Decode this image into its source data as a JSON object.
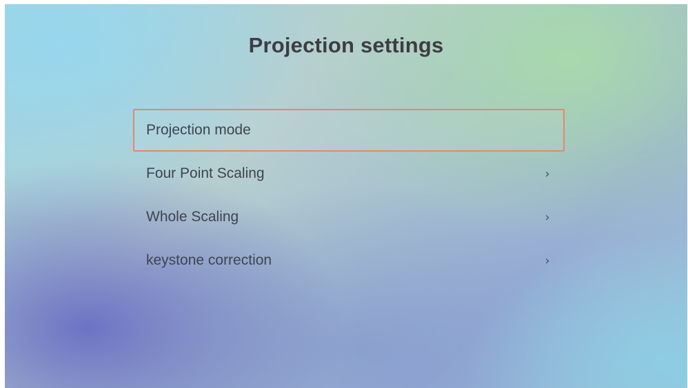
{
  "page": {
    "title": "Projection settings"
  },
  "menu": {
    "items": [
      {
        "label": "Projection mode",
        "has_submenu": false,
        "focused": true
      },
      {
        "label": "Four Point Scaling",
        "has_submenu": true,
        "chevron": "›",
        "focused": false
      },
      {
        "label": "Whole Scaling",
        "has_submenu": true,
        "chevron": "›",
        "focused": false
      },
      {
        "label": "keystone correction",
        "has_submenu": true,
        "chevron": "›",
        "focused": false
      }
    ]
  },
  "colors": {
    "focus_border": "#e08a68",
    "text": "#3f4450",
    "title": "#3d3d44"
  }
}
